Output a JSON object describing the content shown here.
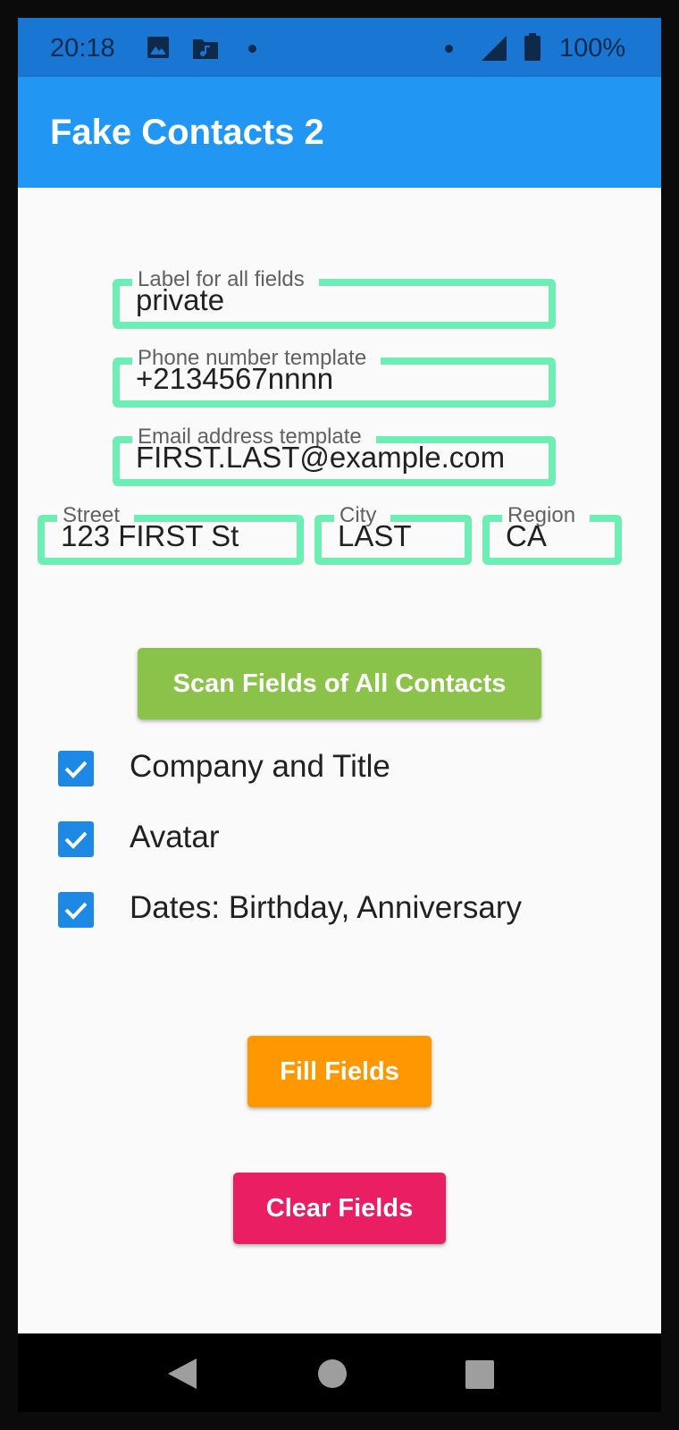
{
  "status_bar": {
    "time": "20:18",
    "battery": "100%",
    "icons": [
      "image-icon",
      "music-folder-icon",
      "dot-icon",
      "dot-icon",
      "signal-icon",
      "battery-icon"
    ]
  },
  "app_bar": {
    "title": "Fake Contacts 2"
  },
  "fields": {
    "label_all": {
      "label": "Label for all fields",
      "value": "private"
    },
    "phone": {
      "label": "Phone number template",
      "value": "+2134567nnnn"
    },
    "email": {
      "label": "Email address template",
      "value": "FIRST.LAST@example.com"
    },
    "street": {
      "label": "Street",
      "value": "123 FIRST St"
    },
    "city": {
      "label": "City",
      "value": "LAST"
    },
    "region": {
      "label": "Region",
      "value": "CA"
    }
  },
  "buttons": {
    "scan": "Scan Fields of All Contacts",
    "fill": "Fill Fields",
    "clear": "Clear Fields"
  },
  "checkboxes": [
    {
      "label": "Company and Title",
      "checked": true
    },
    {
      "label": "Avatar",
      "checked": true
    },
    {
      "label": "Dates: Birthday, Anniversary",
      "checked": true
    }
  ],
  "colors": {
    "status_bar": "#1976D2",
    "app_bar": "#2196F3",
    "field_border": "#6EEDB4",
    "scan_button": "#8BC34A",
    "fill_button": "#FF9800",
    "clear_button": "#E91E63",
    "checkbox": "#1E88E5"
  },
  "nav_bar": {
    "icons": [
      "back-icon",
      "home-icon",
      "recents-icon"
    ]
  }
}
